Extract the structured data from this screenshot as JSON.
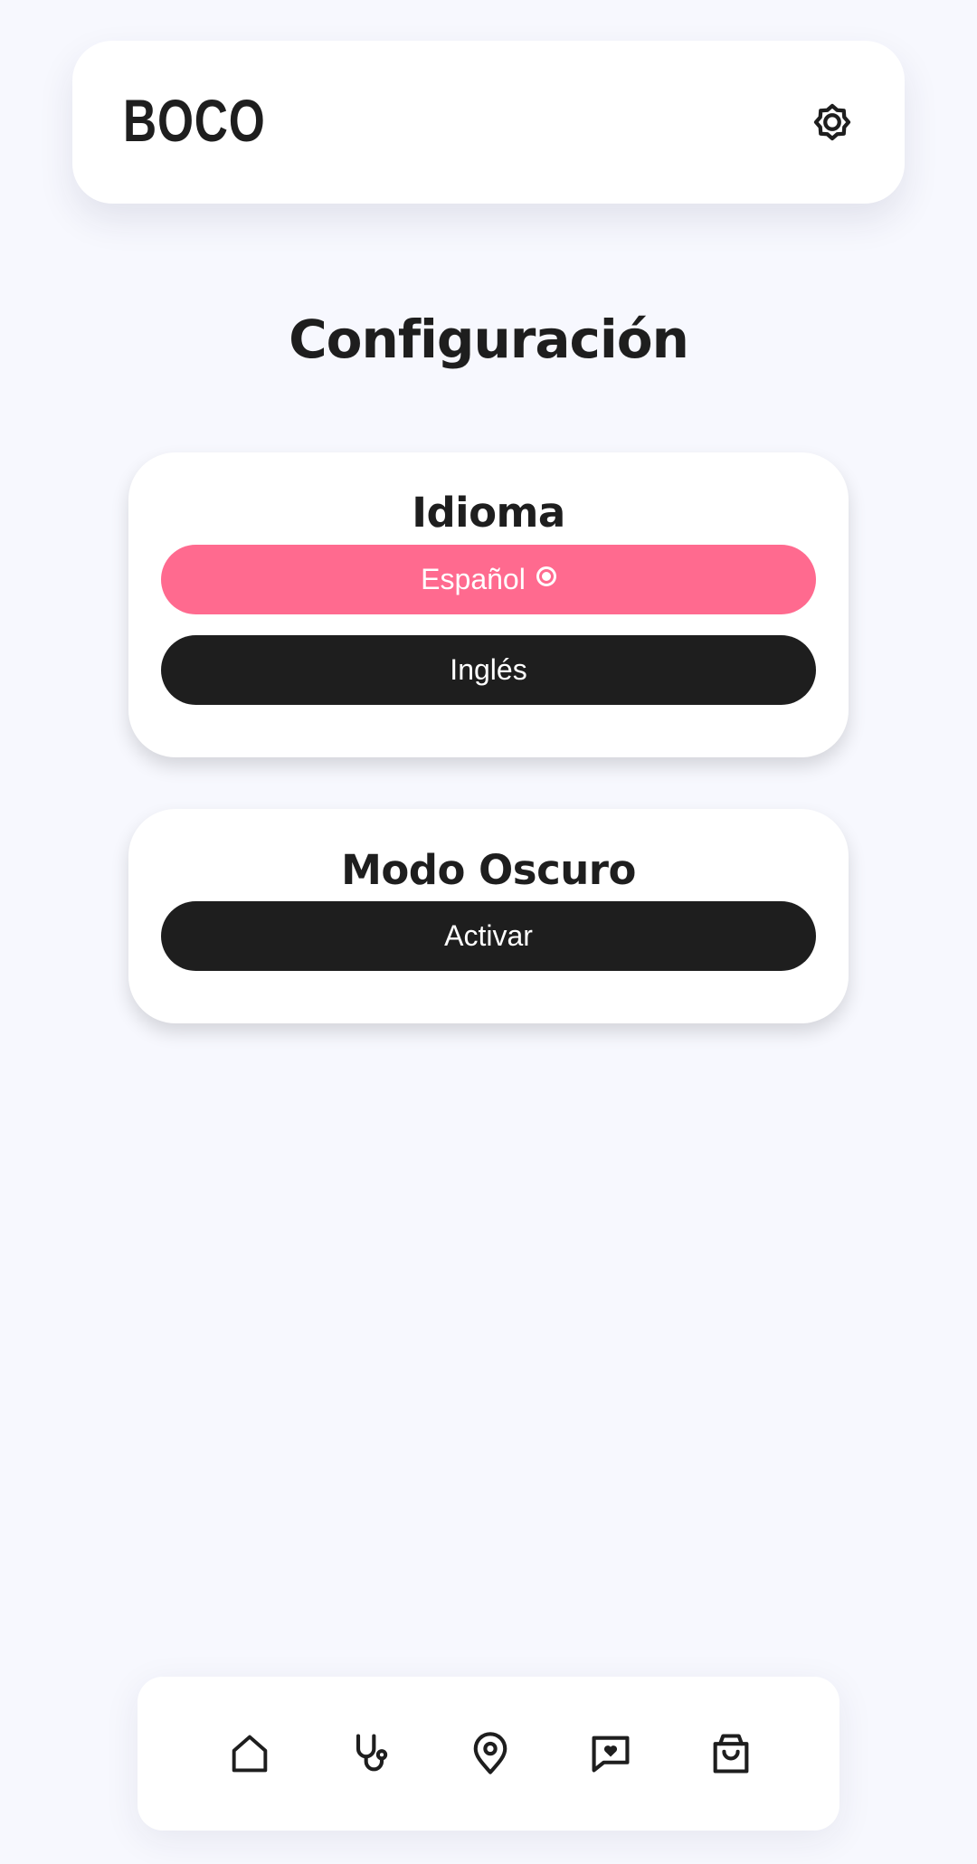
{
  "header": {
    "logo": "BOCO",
    "settings_icon": "gear-icon"
  },
  "page": {
    "title": "Configuración"
  },
  "language_card": {
    "title": "Idioma",
    "options": [
      {
        "label": "Español",
        "selected": true,
        "icon": "radio-selected-icon"
      },
      {
        "label": "Inglés",
        "selected": false
      }
    ]
  },
  "dark_mode_card": {
    "title": "Modo Oscuro",
    "button_label": "Activar"
  },
  "bottom_nav": {
    "items": [
      {
        "icon": "home-icon"
      },
      {
        "icon": "stethoscope-icon"
      },
      {
        "icon": "location-pin-icon"
      },
      {
        "icon": "message-heart-icon"
      },
      {
        "icon": "shopping-bag-icon"
      }
    ]
  },
  "colors": {
    "background": "#f7f8fe",
    "surface": "#ffffff",
    "accent_pink": "#ff6a8f",
    "dark": "#1e1e1e"
  }
}
